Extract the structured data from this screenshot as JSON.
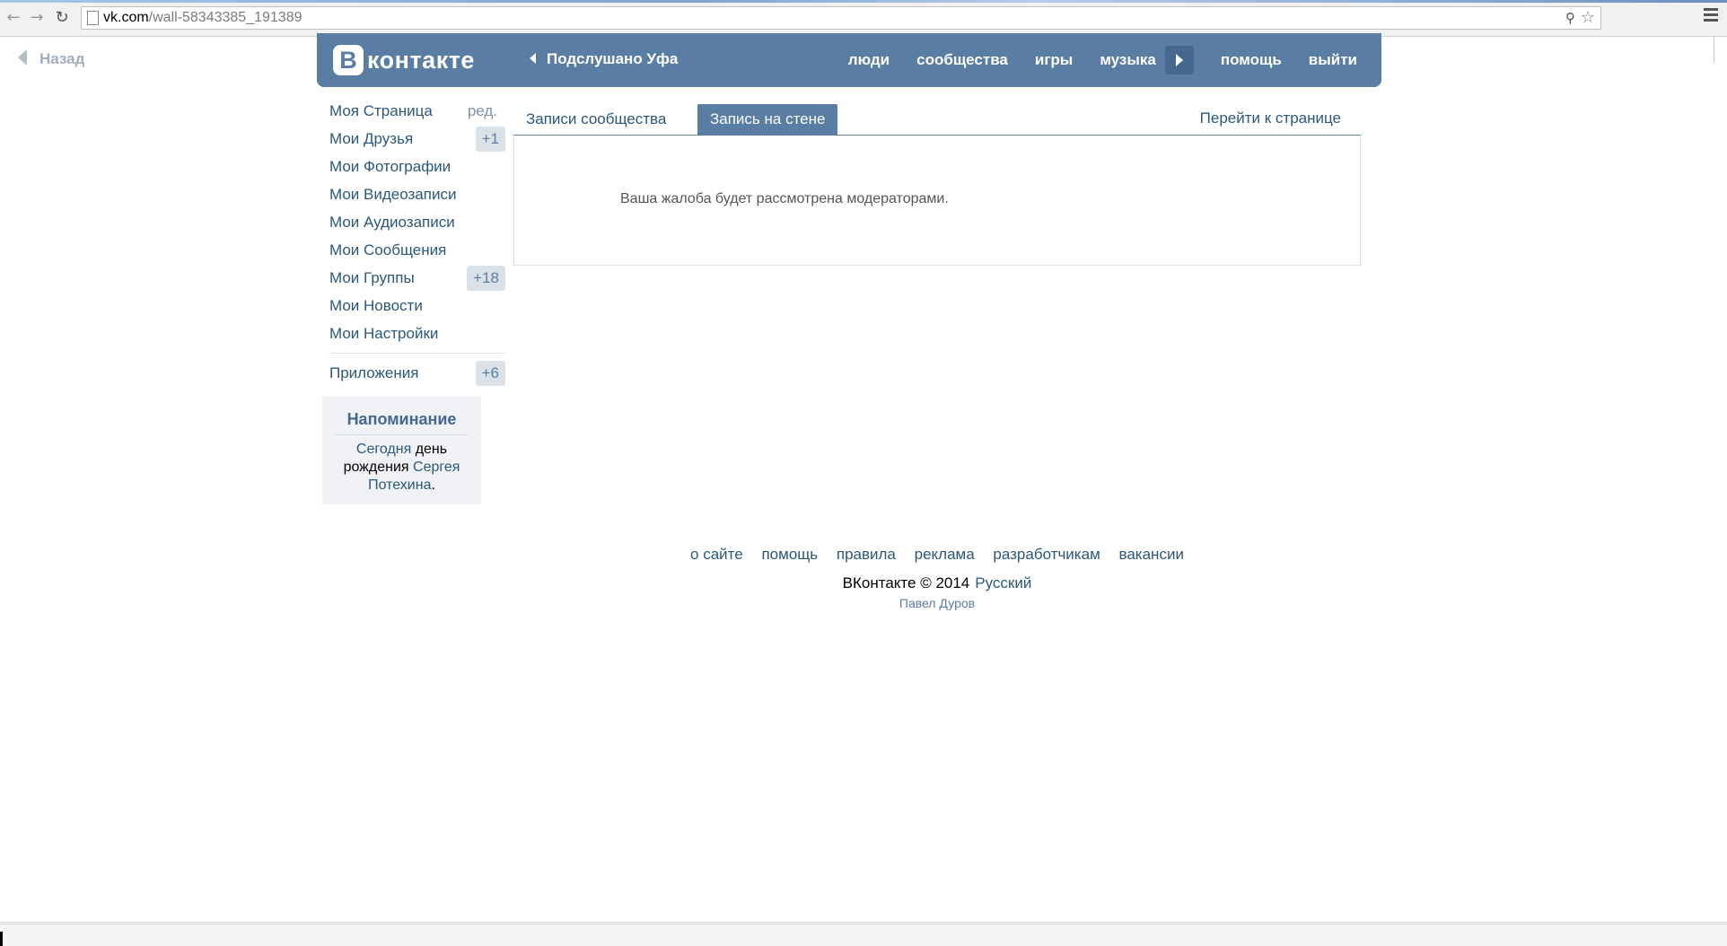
{
  "browser": {
    "url_host": "vk.com",
    "url_path": "/wall-58343385_191389"
  },
  "back_link": {
    "label": "Назад"
  },
  "header": {
    "logo_letter": "В",
    "logo_word": "контакте",
    "group_name": "Подслушано Уфа",
    "nav": {
      "people": "люди",
      "communities": "сообщества",
      "games": "игры",
      "music": "музыка",
      "help": "помощь",
      "logout": "выйти"
    }
  },
  "sidebar": {
    "items": [
      {
        "label": "Моя Страница",
        "extra": "ред."
      },
      {
        "label": "Мои Друзья",
        "count": "+1"
      },
      {
        "label": "Мои Фотографии"
      },
      {
        "label": "Мои Видеозаписи"
      },
      {
        "label": "Мои Аудиозаписи"
      },
      {
        "label": "Мои Сообщения"
      },
      {
        "label": "Мои Группы",
        "count": "+18"
      },
      {
        "label": "Мои Новости"
      },
      {
        "label": "Мои Настройки"
      },
      {
        "label": "Приложения",
        "count": "+6"
      }
    ],
    "reminder": {
      "title": "Напоминание",
      "today": "Сегодня",
      "middle1": "день",
      "middle2": "рождения",
      "name": "Сергея",
      "surname": "Потехина",
      "dot": "."
    }
  },
  "content": {
    "tabs": [
      {
        "label": "Записи сообщества"
      },
      {
        "label": "Запись на стене"
      }
    ],
    "go_to_page": "Перейти к странице",
    "message": "Ваша жалоба будет рассмотрена модераторами."
  },
  "footer": {
    "links": [
      "о сайте",
      "помощь",
      "правила",
      "реклама",
      "разработчикам",
      "вакансии"
    ],
    "copyright": "ВКонтакте © 2014",
    "language": "Русский",
    "author": "Павел Дуров"
  },
  "colors": {
    "brand": "#597da3",
    "link": "#2b587a",
    "counter_bg": "#dae2e8"
  }
}
